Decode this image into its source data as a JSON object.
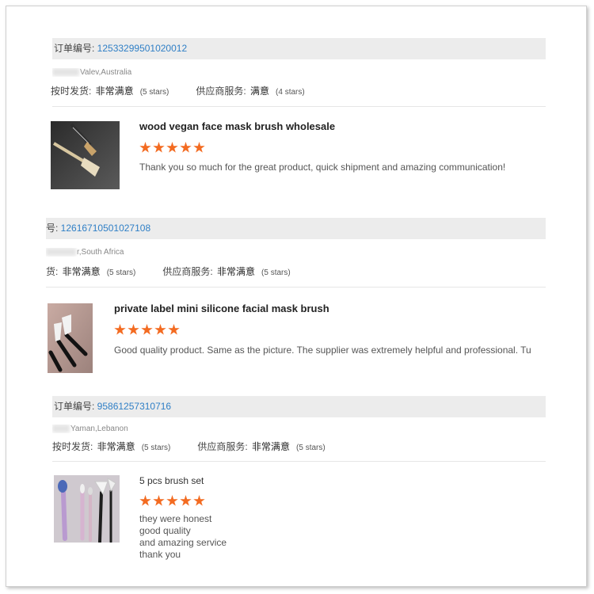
{
  "reviews": [
    {
      "order_label": "订单编号: ",
      "order_number": "12533299501020012",
      "buyer": "Valev,Australia",
      "ship_label": "按时发货: ",
      "ship_value": "非常满意",
      "ship_stars": "(5 stars)",
      "supplier_label": "供应商服务: ",
      "supplier_value": "满意",
      "supplier_stars": "(4 stars)",
      "product_title": "wood vegan face mask brush wholesale",
      "rating": 5,
      "comment": "Thank you so much for the great product, quick shipment and amazing communication!"
    },
    {
      "order_label": "号: ",
      "order_number": "12616710501027108",
      "buyer": "r,South Africa",
      "ship_label": "货: ",
      "ship_value": "非常满意",
      "ship_stars": "(5 stars)",
      "supplier_label": "供应商服务: ",
      "supplier_value": "非常满意",
      "supplier_stars": "(5 stars)",
      "product_title": "private label mini silicone facial mask brush",
      "rating": 5,
      "comment": "Good quality product. Same as the picture. The supplier was extremely helpful and professional. Tu"
    },
    {
      "order_label": "订单编号: ",
      "order_number": "95861257310716",
      "buyer": "Yaman,Lebanon",
      "ship_label": "按时发货: ",
      "ship_value": "非常满意",
      "ship_stars": "(5 stars)",
      "supplier_label": "供应商服务: ",
      "supplier_value": "非常满意",
      "supplier_stars": "(5 stars)",
      "product_title": "5 pcs brush set",
      "rating": 5,
      "comment_lines": [
        "they were honest",
        "good quality",
        "and amazing service",
        "thank you"
      ]
    }
  ],
  "colors": {
    "star": "#f36b21",
    "order_number": "#2f7fc6",
    "order_bar": "#ececec"
  }
}
